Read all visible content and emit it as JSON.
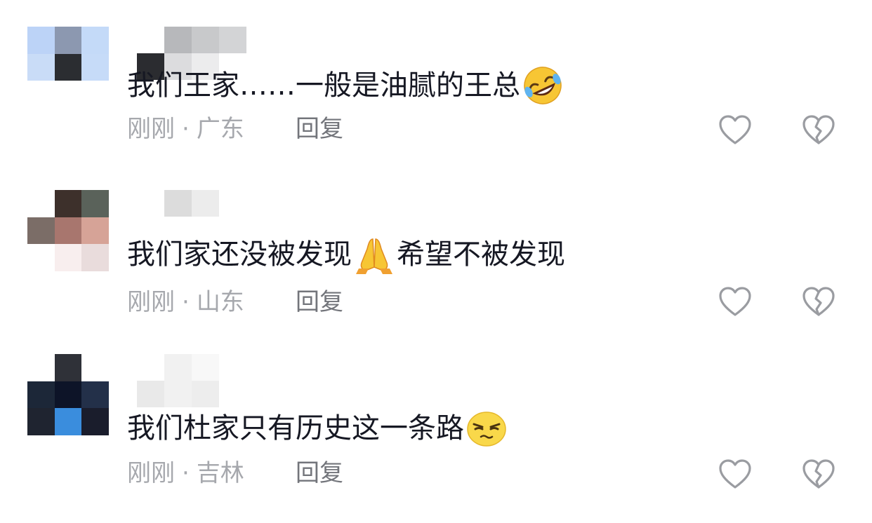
{
  "colors": {
    "text": "#161823",
    "meta": "#a6a8ad",
    "reply": "#73757b",
    "icon": "#9a9ca1"
  },
  "comments": [
    {
      "text_before": "我们王家……一般是油腻的王总",
      "emoji": "rolling-on-floor-laughing-emoji",
      "text_after": "",
      "time": "刚刚",
      "separator": "·",
      "location": "广东",
      "reply_label": "回复",
      "avatar_colors": [
        "#bcd3f7",
        "#8c98b0",
        "#c4daf8",
        "#c9dcf7",
        "#2b2d31",
        "#c6dbf8",
        "#ffffff",
        "#ffffff",
        "#ffffff"
      ],
      "name_colors": [
        [
          "#ffffff",
          "#b7b8bb",
          "#c8c9cb",
          "#d3d4d6"
        ],
        [
          "#2b2c30",
          "#dcdcde",
          "#ececed",
          "#ffffff"
        ]
      ]
    },
    {
      "text_before": "我们家还没被发现",
      "emoji": "folded-hands-emoji",
      "text_after": "希望不被发现",
      "time": "刚刚",
      "separator": "·",
      "location": "山东",
      "reply_label": "回复",
      "avatar_colors": [
        "#ffffff",
        "#3d302b",
        "#5a625a",
        "#7b6d67",
        "#a8766e",
        "#d6a397",
        "#ffffff",
        "#f8eeee",
        "#e9dcdc"
      ],
      "name_colors": [
        [
          "#ffffff",
          "#dcdcdc",
          "#ececec",
          "#ffffff"
        ],
        [
          "#ffffff",
          "#ffffff",
          "#ffffff",
          "#ffffff"
        ]
      ]
    },
    {
      "text_before": "我们杜家只有历史这一条路",
      "emoji": "unamused-face-emoji",
      "text_after": "",
      "time": "刚刚",
      "separator": "·",
      "location": "吉林",
      "reply_label": "回复",
      "avatar_colors": [
        "#ffffff",
        "#2f3138",
        "#ffffff",
        "#1c2738",
        "#0d1428",
        "#233049",
        "#1f2430",
        "#3a8ddd",
        "#1a1d2c"
      ],
      "name_colors": [
        [
          "#ffffff",
          "#f1f1f1",
          "#f8f8f8",
          "#ffffff"
        ],
        [
          "#e9e9e9",
          "#f1f1f1",
          "#ededed",
          "#ffffff"
        ]
      ]
    }
  ]
}
